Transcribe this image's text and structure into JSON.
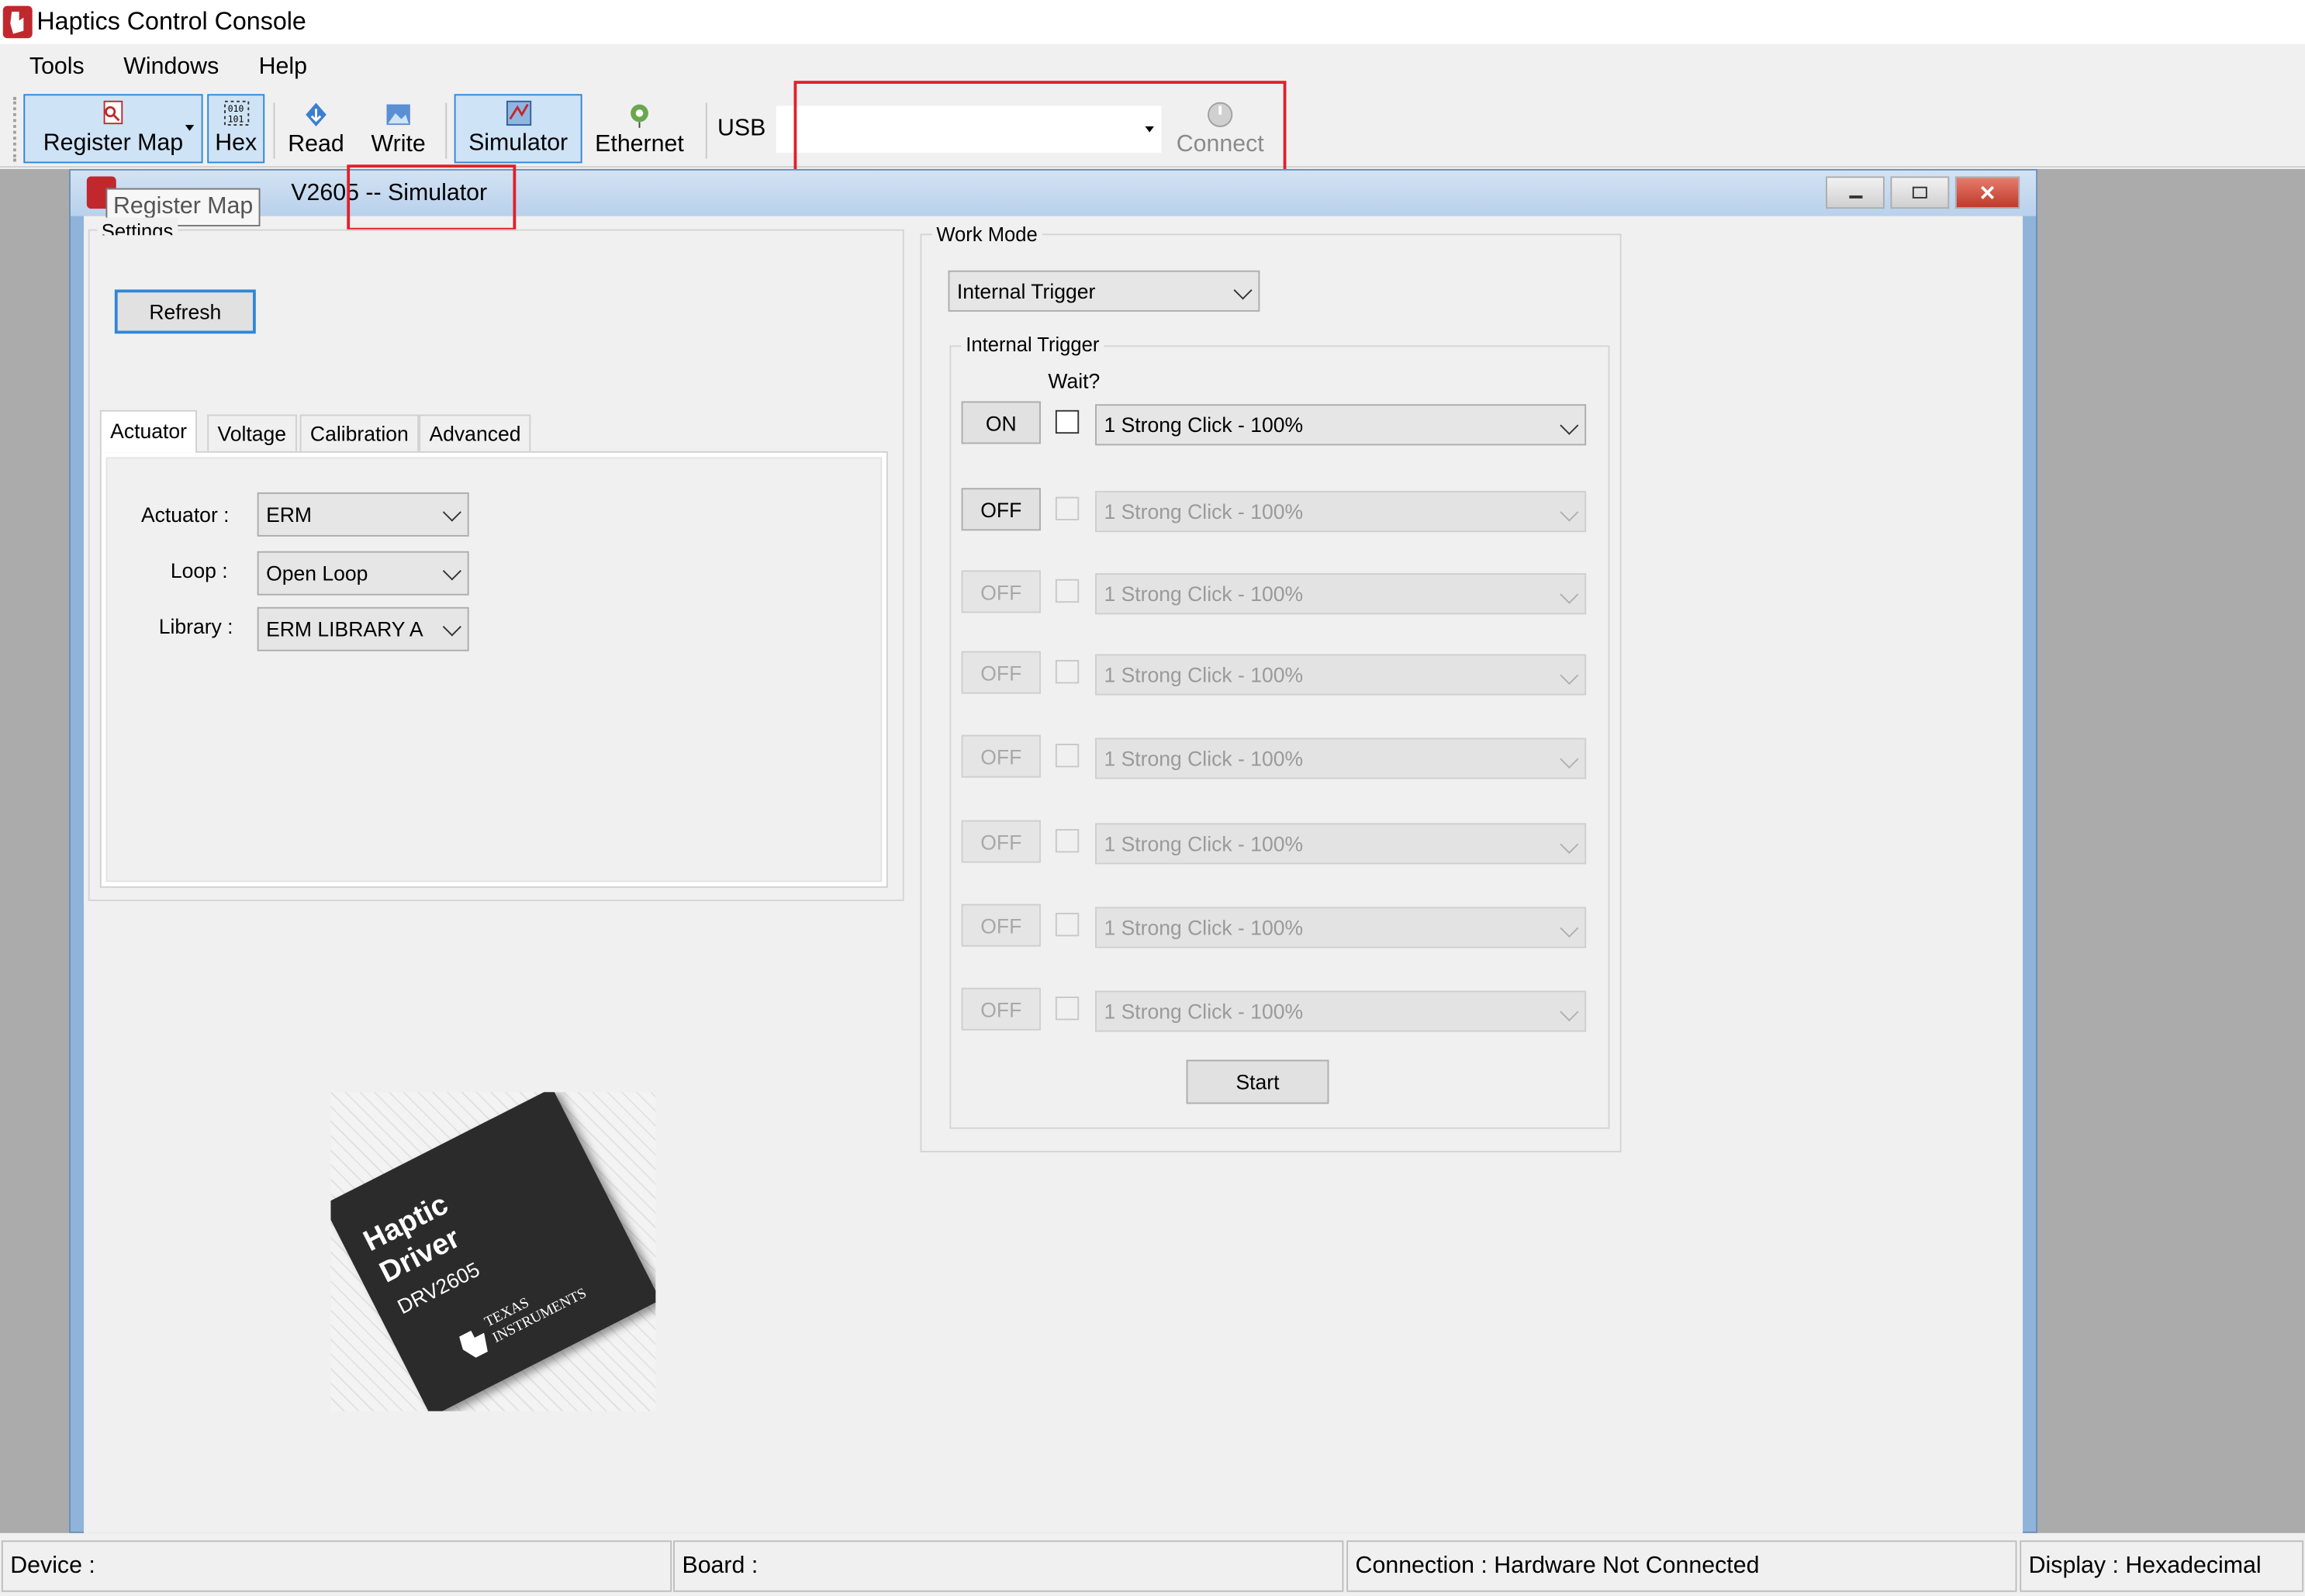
{
  "app": {
    "title": "Haptics Control Console"
  },
  "menu": [
    "Tools",
    "Windows",
    "Help"
  ],
  "toolbar": {
    "register_map": "Register Map",
    "hex": "Hex",
    "read": "Read",
    "write": "Write",
    "simulator": "Simulator",
    "ethernet": "Ethernet",
    "usb": "USB",
    "usb_value": "",
    "connect": "Connect"
  },
  "child_window": {
    "title_left": "Simulator - DRV2605",
    "title_right": "-- Simulator",
    "title_visible_fragment": "V2605",
    "tooltip": "Register Map"
  },
  "settings": {
    "legend": "Settings",
    "refresh": "Refresh",
    "tabs": [
      "Actuator",
      "Voltage",
      "Calibration",
      "Advanced"
    ],
    "actuator_label": "Actuator :",
    "actuator_value": "ERM",
    "loop_label": "Loop :",
    "loop_value": "Open Loop",
    "library_label": "Library :",
    "library_value": "ERM LIBRARY A"
  },
  "chip": {
    "line1": "Haptic",
    "line2": "Driver",
    "line3": "DRV2605",
    "brand1": "TEXAS",
    "brand2": "INSTRUMENTS"
  },
  "work_mode": {
    "legend": "Work Mode",
    "mode_value": "Internal Trigger",
    "group_legend": "Internal Trigger",
    "wait_label": "Wait?",
    "rows": [
      {
        "toggle": "ON",
        "effect": "1 Strong Click - 100%"
      },
      {
        "toggle": "OFF",
        "effect": "1 Strong Click - 100%"
      },
      {
        "toggle": "OFF",
        "effect": "1 Strong Click - 100%"
      },
      {
        "toggle": "OFF",
        "effect": "1 Strong Click - 100%"
      },
      {
        "toggle": "OFF",
        "effect": "1 Strong Click - 100%"
      },
      {
        "toggle": "OFF",
        "effect": "1 Strong Click - 100%"
      },
      {
        "toggle": "OFF",
        "effect": "1 Strong Click - 100%"
      },
      {
        "toggle": "OFF",
        "effect": "1 Strong Click - 100%"
      }
    ],
    "start": "Start"
  },
  "status_bar": {
    "device": "Device :",
    "board": "Board :",
    "connection": "Connection : Hardware Not Connected",
    "display": "Display : Hexadecimal"
  },
  "colors": {
    "highlight_red": "#e0202a",
    "active_blue": "#2f87d8",
    "chip_dark": "#2b2b2b"
  }
}
